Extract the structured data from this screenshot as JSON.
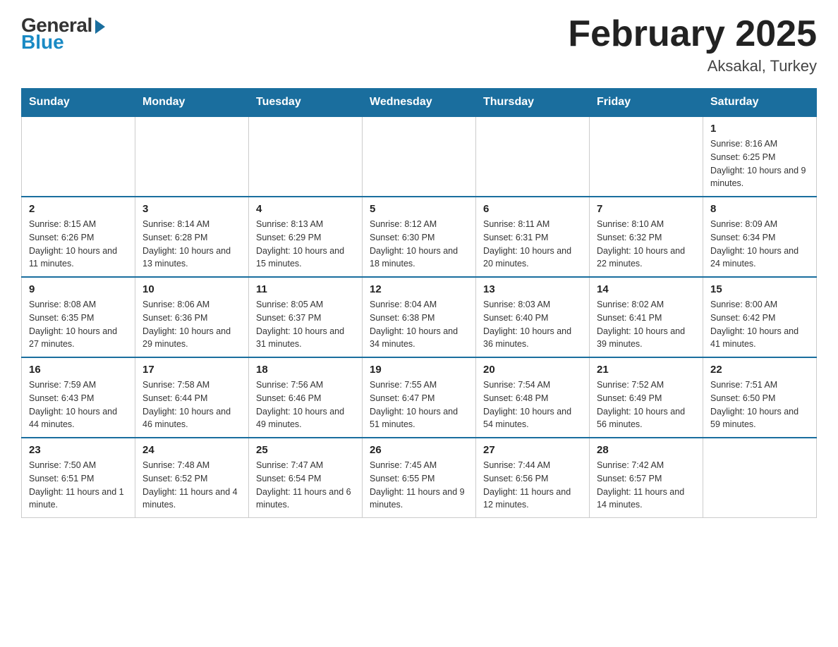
{
  "header": {
    "logo": {
      "general": "General",
      "blue": "Blue"
    },
    "title": "February 2025",
    "location": "Aksakal, Turkey"
  },
  "days_of_week": [
    "Sunday",
    "Monday",
    "Tuesday",
    "Wednesday",
    "Thursday",
    "Friday",
    "Saturday"
  ],
  "weeks": [
    [
      {
        "day": "",
        "info": ""
      },
      {
        "day": "",
        "info": ""
      },
      {
        "day": "",
        "info": ""
      },
      {
        "day": "",
        "info": ""
      },
      {
        "day": "",
        "info": ""
      },
      {
        "day": "",
        "info": ""
      },
      {
        "day": "1",
        "info": "Sunrise: 8:16 AM\nSunset: 6:25 PM\nDaylight: 10 hours and 9 minutes."
      }
    ],
    [
      {
        "day": "2",
        "info": "Sunrise: 8:15 AM\nSunset: 6:26 PM\nDaylight: 10 hours and 11 minutes."
      },
      {
        "day": "3",
        "info": "Sunrise: 8:14 AM\nSunset: 6:28 PM\nDaylight: 10 hours and 13 minutes."
      },
      {
        "day": "4",
        "info": "Sunrise: 8:13 AM\nSunset: 6:29 PM\nDaylight: 10 hours and 15 minutes."
      },
      {
        "day": "5",
        "info": "Sunrise: 8:12 AM\nSunset: 6:30 PM\nDaylight: 10 hours and 18 minutes."
      },
      {
        "day": "6",
        "info": "Sunrise: 8:11 AM\nSunset: 6:31 PM\nDaylight: 10 hours and 20 minutes."
      },
      {
        "day": "7",
        "info": "Sunrise: 8:10 AM\nSunset: 6:32 PM\nDaylight: 10 hours and 22 minutes."
      },
      {
        "day": "8",
        "info": "Sunrise: 8:09 AM\nSunset: 6:34 PM\nDaylight: 10 hours and 24 minutes."
      }
    ],
    [
      {
        "day": "9",
        "info": "Sunrise: 8:08 AM\nSunset: 6:35 PM\nDaylight: 10 hours and 27 minutes."
      },
      {
        "day": "10",
        "info": "Sunrise: 8:06 AM\nSunset: 6:36 PM\nDaylight: 10 hours and 29 minutes."
      },
      {
        "day": "11",
        "info": "Sunrise: 8:05 AM\nSunset: 6:37 PM\nDaylight: 10 hours and 31 minutes."
      },
      {
        "day": "12",
        "info": "Sunrise: 8:04 AM\nSunset: 6:38 PM\nDaylight: 10 hours and 34 minutes."
      },
      {
        "day": "13",
        "info": "Sunrise: 8:03 AM\nSunset: 6:40 PM\nDaylight: 10 hours and 36 minutes."
      },
      {
        "day": "14",
        "info": "Sunrise: 8:02 AM\nSunset: 6:41 PM\nDaylight: 10 hours and 39 minutes."
      },
      {
        "day": "15",
        "info": "Sunrise: 8:00 AM\nSunset: 6:42 PM\nDaylight: 10 hours and 41 minutes."
      }
    ],
    [
      {
        "day": "16",
        "info": "Sunrise: 7:59 AM\nSunset: 6:43 PM\nDaylight: 10 hours and 44 minutes."
      },
      {
        "day": "17",
        "info": "Sunrise: 7:58 AM\nSunset: 6:44 PM\nDaylight: 10 hours and 46 minutes."
      },
      {
        "day": "18",
        "info": "Sunrise: 7:56 AM\nSunset: 6:46 PM\nDaylight: 10 hours and 49 minutes."
      },
      {
        "day": "19",
        "info": "Sunrise: 7:55 AM\nSunset: 6:47 PM\nDaylight: 10 hours and 51 minutes."
      },
      {
        "day": "20",
        "info": "Sunrise: 7:54 AM\nSunset: 6:48 PM\nDaylight: 10 hours and 54 minutes."
      },
      {
        "day": "21",
        "info": "Sunrise: 7:52 AM\nSunset: 6:49 PM\nDaylight: 10 hours and 56 minutes."
      },
      {
        "day": "22",
        "info": "Sunrise: 7:51 AM\nSunset: 6:50 PM\nDaylight: 10 hours and 59 minutes."
      }
    ],
    [
      {
        "day": "23",
        "info": "Sunrise: 7:50 AM\nSunset: 6:51 PM\nDaylight: 11 hours and 1 minute."
      },
      {
        "day": "24",
        "info": "Sunrise: 7:48 AM\nSunset: 6:52 PM\nDaylight: 11 hours and 4 minutes."
      },
      {
        "day": "25",
        "info": "Sunrise: 7:47 AM\nSunset: 6:54 PM\nDaylight: 11 hours and 6 minutes."
      },
      {
        "day": "26",
        "info": "Sunrise: 7:45 AM\nSunset: 6:55 PM\nDaylight: 11 hours and 9 minutes."
      },
      {
        "day": "27",
        "info": "Sunrise: 7:44 AM\nSunset: 6:56 PM\nDaylight: 11 hours and 12 minutes."
      },
      {
        "day": "28",
        "info": "Sunrise: 7:42 AM\nSunset: 6:57 PM\nDaylight: 11 hours and 14 minutes."
      },
      {
        "day": "",
        "info": ""
      }
    ]
  ]
}
